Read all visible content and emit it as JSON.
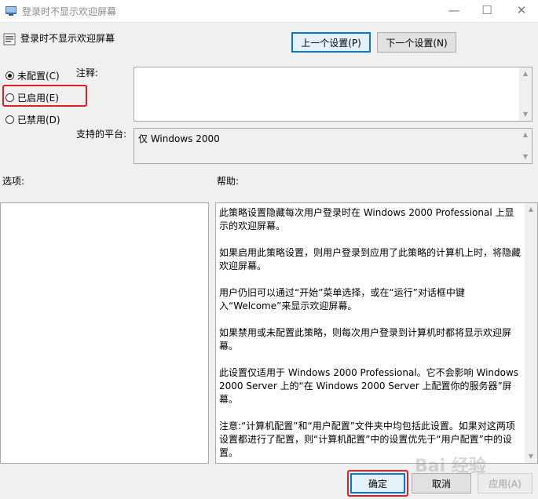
{
  "window": {
    "title": "登录时不显示欢迎屏幕",
    "controls": {
      "minimize": "—",
      "maximize": "☐",
      "close": "✕"
    }
  },
  "policy": {
    "title": "登录时不显示欢迎屏幕"
  },
  "nav": {
    "prev_label": "上一个设置(P)",
    "next_label": "下一个设置(N)"
  },
  "state": {
    "options": [
      {
        "label": "未配置(C)",
        "checked": true
      },
      {
        "label": "已启用(E)",
        "checked": false
      },
      {
        "label": "已禁用(D)",
        "checked": false
      }
    ]
  },
  "comment": {
    "label": "注释:",
    "value": ""
  },
  "platform": {
    "label": "支持的平台:",
    "value": "仅 Windows 2000"
  },
  "options_section": {
    "label": "选项:"
  },
  "help": {
    "label": "帮助:",
    "paragraphs": [
      "此策略设置隐藏每次用户登录时在 Windows 2000 Professional 上显示的欢迎屏幕。",
      "如果启用此策略设置，则用户登录到应用了此策略的计算机上时，将隐藏欢迎屏幕。",
      "用户仍旧可以通过“开始”菜单选择，或在“运行”对话框中键入“Welcome”来显示欢迎屏幕。",
      "如果禁用或未配置此策略，则每次用户登录到计算机时都将显示欢迎屏幕。",
      "此设置仅适用于 Windows 2000 Professional。它不会影响 Windows 2000 Server 上的“在 Windows 2000 Server 上配置你的服务器”屏幕。",
      "注意:“计算机配置”和“用户配置”文件夹中均包括此设置。如果对这两项设置都进行了配置，则“计算机配置”中的设置优先于“用户配置”中的设置。"
    ]
  },
  "buttons": {
    "ok": "确定",
    "cancel": "取消",
    "apply": "应用(A)"
  },
  "watermark": "Bai 经验",
  "colors": {
    "accent": "#0078d7",
    "highlight": "#e02020"
  }
}
